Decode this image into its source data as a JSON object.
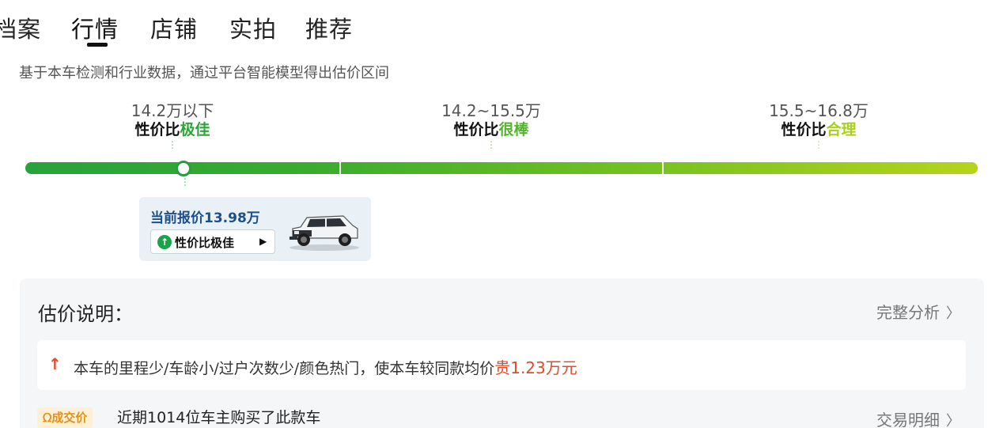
{
  "tabs": [
    {
      "label": "档案",
      "active": false
    },
    {
      "label": "行情",
      "active": true
    },
    {
      "label": "店铺",
      "active": false
    },
    {
      "label": "实拍",
      "active": false
    },
    {
      "label": "推荐",
      "active": false
    }
  ],
  "subtitle": "基于本车检测和行业数据，通过平台智能模型得出估价区间",
  "ranges": [
    {
      "price": "14.2万以下",
      "prefix": "性价比",
      "level": "极佳",
      "color": "#2ea43b"
    },
    {
      "price": "14.2~15.5万",
      "prefix": "性价比",
      "level": "很棒",
      "color": "#52b52a"
    },
    {
      "price": "15.5~16.8万",
      "prefix": "性价比",
      "level": "合理",
      "color": "#a8d11c"
    }
  ],
  "current": {
    "price_text": "当前报价13.98万",
    "badge_text": "性价比极佳",
    "badge_icon": "arrow-up-circle-icon",
    "badge_arrow": "▶"
  },
  "explanation": {
    "title": "估价说明：",
    "full_link": "完整分析",
    "note_prefix": "本车的里程少/车龄小/过户次数少/颜色热门，使本车较同款均价",
    "note_highlight": "贵1.23万元",
    "deal_badge": "成交价",
    "deal_text": "近期1014位车主购买了此款车",
    "deal_link": "交易明细"
  },
  "colors": {
    "accent_green": "#24a13a",
    "price_up_red": "#e24a2a",
    "badge_orange": "#e2921b"
  }
}
